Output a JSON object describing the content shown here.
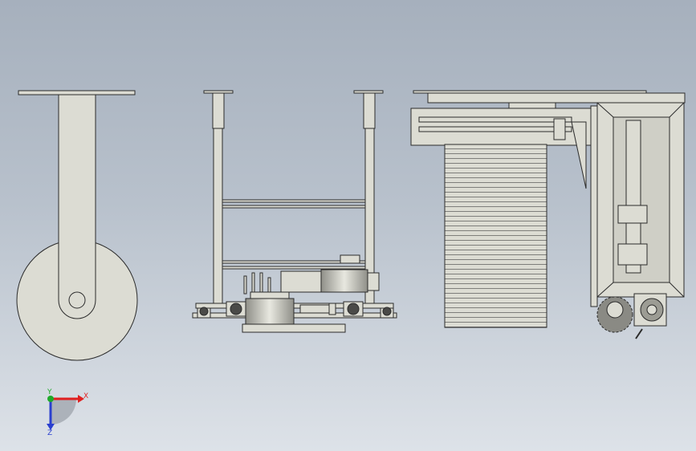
{
  "triad": {
    "x_label": "X",
    "y_label": "Y",
    "z_label": "Z",
    "x_color": "#e02020",
    "y_color": "#1faa2a",
    "z_color": "#2a3fcf"
  },
  "palette": {
    "part_fill": "#dcdcd3",
    "part_stroke": "#2b2b2b",
    "shade": "#9c9c94",
    "dark": "#4a4a48"
  },
  "views": [
    {
      "name": "side-view-wheel"
    },
    {
      "name": "front-view-frame"
    },
    {
      "name": "side-view-mechanism"
    }
  ]
}
